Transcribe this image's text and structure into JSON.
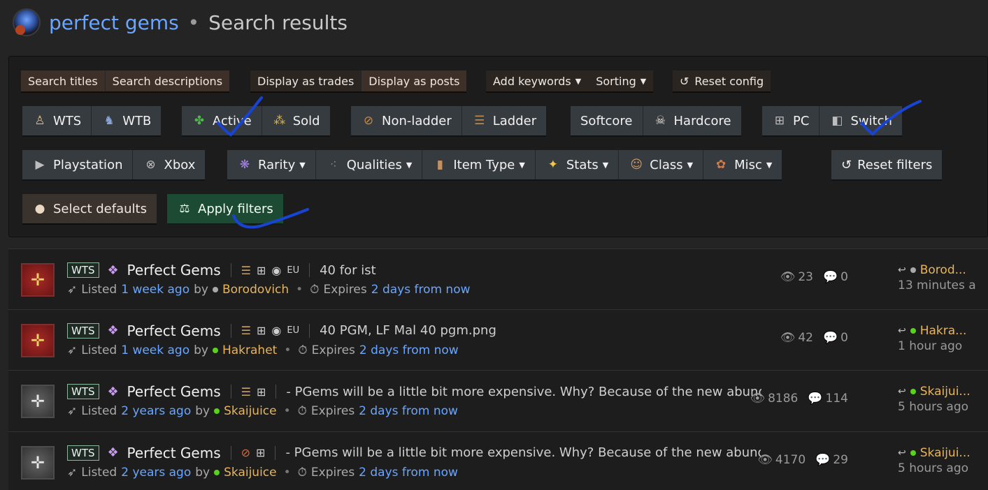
{
  "header": {
    "search_query": "perfect gems",
    "separator": "•",
    "title_suffix": "Search results"
  },
  "filters": {
    "search_mode": [
      "Search titles",
      "Search descriptions"
    ],
    "display_mode": [
      "Display as trades",
      "Display as posts"
    ],
    "config": [
      "Add keywords",
      "Sorting",
      "Reset config"
    ],
    "trade_type": [
      "WTS",
      "WTB"
    ],
    "status": [
      "Active",
      "Sold"
    ],
    "ladder": [
      "Non-ladder",
      "Ladder"
    ],
    "core": [
      "Softcore",
      "Hardcore"
    ],
    "platform_pc": [
      "PC",
      "Switch"
    ],
    "platform_console": [
      "Playstation",
      "Xbox"
    ],
    "dropdowns": [
      "Rarity",
      "Qualities",
      "Item Type",
      "Stats",
      "Class",
      "Misc"
    ],
    "reset_filters": "Reset filters",
    "select_defaults": "Select defaults",
    "apply_filters": "Apply filters"
  },
  "results": [
    {
      "badge": "WTS",
      "title": "Perfect Gems",
      "region": "EU",
      "snippet": "40 for ist",
      "listed_prefix": "Listed",
      "listed_ago": "1 week ago",
      "by": "by",
      "author": "Borodovich",
      "expires_prefix": "Expires",
      "expires_in": "2 days from now",
      "views": "23",
      "comments": "0",
      "latest_user": "Borod...",
      "latest_time": "13 minutes a"
    },
    {
      "badge": "WTS",
      "title": "Perfect Gems",
      "region": "EU",
      "snippet": "40 PGM, LF Mal 40 pgm.png",
      "listed_prefix": "Listed",
      "listed_ago": "1 week ago",
      "by": "by",
      "author": "Hakrahet",
      "expires_prefix": "Expires",
      "expires_in": "2 days from now",
      "views": "42",
      "comments": "0",
      "latest_user": "Hakra...",
      "latest_time": "1 hour ago"
    },
    {
      "badge": "WTS",
      "title": "Perfect Gems",
      "region": "",
      "snippet": "- PGems will be a little bit more expensive. Why? Because of the new abunda",
      "listed_prefix": "Listed",
      "listed_ago": "2 years ago",
      "by": "by",
      "author": "Skaijuice",
      "expires_prefix": "Expires",
      "expires_in": "2 days from now",
      "views": "8186",
      "comments": "114",
      "latest_user": "Skaijui...",
      "latest_time": "5 hours ago"
    },
    {
      "badge": "WTS",
      "title": "Perfect Gems",
      "region": "",
      "snippet": "- PGems will be a little bit more expensive. Why? Because of the new abunda",
      "listed_prefix": "Listed",
      "listed_ago": "2 years ago",
      "by": "by",
      "author": "Skaijuice",
      "expires_prefix": "Expires",
      "expires_in": "2 days from now",
      "views": "4170",
      "comments": "29",
      "latest_user": "Skaijui...",
      "latest_time": "5 hours ago"
    }
  ],
  "colors": {
    "link": "#6aa6ff",
    "username": "#e7b45c",
    "online": "#59d21b",
    "apply_button": "#1d4a33",
    "pen_annotation": "#1844d6"
  }
}
